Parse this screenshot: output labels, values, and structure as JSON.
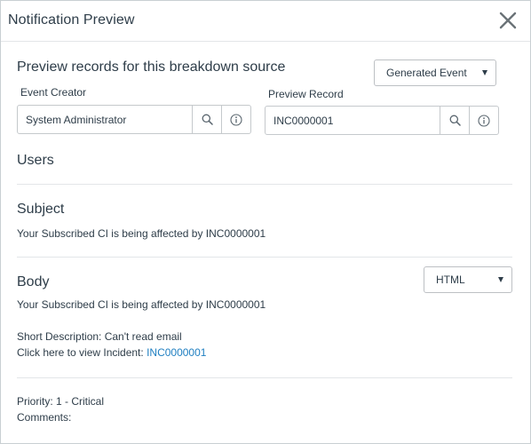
{
  "dialog": {
    "title": "Notification Preview"
  },
  "preview": {
    "heading": "Preview records for this breakdown source",
    "source_select": {
      "value": "Generated Event"
    },
    "event_creator": {
      "label": "Event Creator",
      "value": "System Administrator"
    },
    "preview_record": {
      "label": "Preview Record",
      "value": "INC0000001"
    }
  },
  "users": {
    "heading": "Users"
  },
  "subject": {
    "heading": "Subject",
    "text": "Your Subscribed CI is being affected by INC0000001"
  },
  "body": {
    "heading": "Body",
    "format_select": {
      "value": "HTML"
    },
    "line1": "Your Subscribed CI is being affected by INC0000001",
    "short_description": "Short Description: Can't read email",
    "click_prefix": "Click here to view Incident: ",
    "incident_link": "INC0000001",
    "priority": "Priority: 1 - Critical",
    "comments": "Comments:"
  },
  "icons": {
    "close": "close-icon",
    "search": "search-icon",
    "info": "info-icon",
    "caret": "caret-down-icon"
  },
  "colors": {
    "text": "#2e3d49",
    "link": "#1f7fc1",
    "border": "#c5c9cc",
    "divider": "#e3e6e8"
  }
}
